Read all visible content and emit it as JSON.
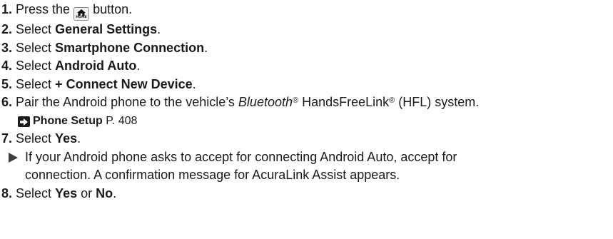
{
  "steps": [
    {
      "num": "1.",
      "pre": "Press the ",
      "icon_name": "home-icon",
      "icon_label": "HOME",
      "post": " button."
    },
    {
      "num": "2.",
      "pre": "Select ",
      "bold": "General Settings",
      "post": "."
    },
    {
      "num": "3.",
      "pre": "Select ",
      "bold": "Smartphone Connection",
      "post": "."
    },
    {
      "num": "4.",
      "pre": "Select ",
      "bold": "Android Auto",
      "post": "."
    },
    {
      "num": "5.",
      "pre": "Select ",
      "bold": "+ Connect New Device",
      "post": "."
    },
    {
      "num": "6.",
      "pre": "Pair the Android phone to the vehicle’s ",
      "italic": "Bluetooth",
      "reg1": "®",
      "mid": " HandsFreeLink",
      "reg2": "®",
      "post": " (HFL) system."
    },
    {
      "num": "7.",
      "pre": "Select ",
      "bold": "Yes",
      "post": "."
    },
    {
      "num": "8.",
      "pre": "Select ",
      "bold": "Yes",
      "mid": " or ",
      "bold2": "No",
      "post": "."
    }
  ],
  "reference": {
    "icon_name": "reference-arrow-icon",
    "title": "Phone Setup",
    "page": " P. 408"
  },
  "note": {
    "icon_name": "triangle-bullet-icon",
    "line1": "If your Android phone asks to accept for connecting Android Auto, accept for",
    "line2": "connection. A confirmation message for AcuraLink Assist appears."
  },
  "colors": {
    "text": "#1a1a1a",
    "icon_border": "#8a8a8a",
    "bullet": "#3d3d3d"
  }
}
